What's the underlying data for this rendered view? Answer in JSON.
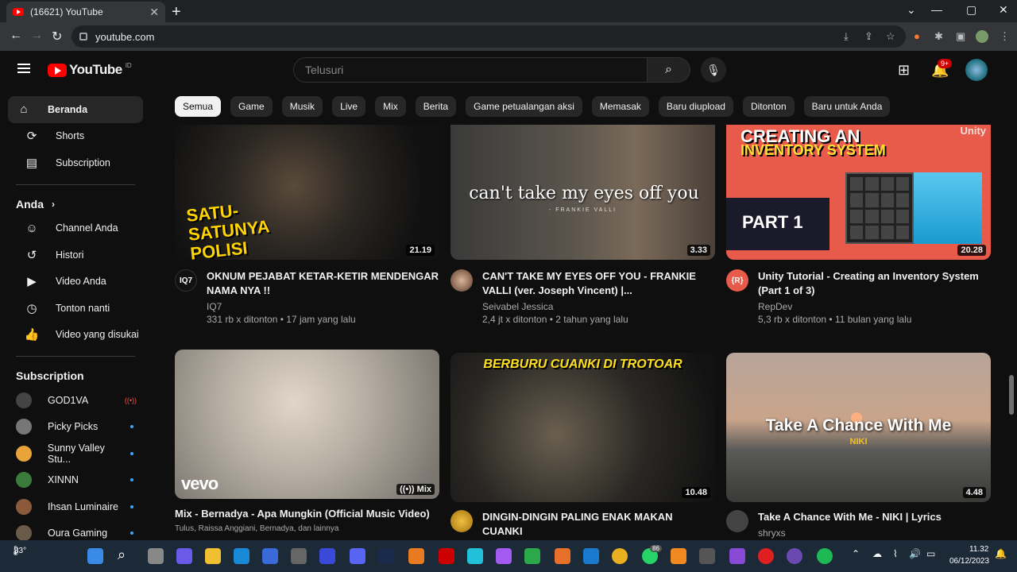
{
  "browser": {
    "tab_title": "(16621) YouTube",
    "url": "youtube.com"
  },
  "youtube": {
    "logo_text": "YouTube",
    "country_code": "ID",
    "search_placeholder": "Telusuri",
    "notifications_badge": "9+"
  },
  "sidebar": {
    "main": [
      {
        "label": "Beranda",
        "icon": "home-icon",
        "glyph": "⌂"
      },
      {
        "label": "Shorts",
        "icon": "shorts-icon",
        "glyph": "⟳"
      },
      {
        "label": "Subscription",
        "icon": "subscriptions-icon",
        "glyph": "▤"
      }
    ],
    "you_heading": "Anda",
    "you": [
      {
        "label": "Channel Anda",
        "icon": "channel-icon",
        "glyph": "☺"
      },
      {
        "label": "Histori",
        "icon": "history-icon",
        "glyph": "↺"
      },
      {
        "label": "Video Anda",
        "icon": "your-videos-icon",
        "glyph": "▶"
      },
      {
        "label": "Tonton nanti",
        "icon": "watch-later-icon",
        "glyph": "◷"
      },
      {
        "label": "Video yang disukai",
        "icon": "liked-videos-icon",
        "glyph": "👍"
      }
    ],
    "subs_heading": "Subscription",
    "subs": [
      {
        "label": "GOD1VA",
        "color": "#444",
        "status": "live"
      },
      {
        "label": "Picky Picks",
        "color": "#777",
        "status": "new"
      },
      {
        "label": "Sunny Valley Stu...",
        "color": "#e8a33a",
        "status": "new"
      },
      {
        "label": "XINNN",
        "color": "#3a7a3a",
        "status": "new"
      },
      {
        "label": "Ihsan Luminaire",
        "color": "#8a5a3a",
        "status": "new"
      },
      {
        "label": "Oura Gaming",
        "color": "#6a5a4a",
        "status": "new"
      }
    ]
  },
  "chips": [
    "Semua",
    "Game",
    "Musik",
    "Live",
    "Mix",
    "Berita",
    "Game petualangan aksi",
    "Memasak",
    "Baru diupload",
    "Ditonton",
    "Baru untuk Anda"
  ],
  "videos": [
    {
      "title": "OKNUM PEJABAT KETAR-KETIR MENDENGAR NAMA NYA !!",
      "channel": "IQ7",
      "meta": "331 rb x ditonton • 17 jam yang lalu",
      "duration": "21.19",
      "avatar_text": "IQ7",
      "thumb_text": "SATU-SATUNYA POLISI BRUTAL"
    },
    {
      "title": "CAN'T TAKE MY EYES OFF YOU - FRANKIE VALLI (ver. Joseph Vincent) |...",
      "channel": "Seivabel Jessica",
      "meta": "2,4 jt x ditonton • 2 tahun yang lalu",
      "duration": "3.33",
      "avatar_text": "",
      "thumb_text": "can't take my eyes off you",
      "thumb_sub": "- FRANKIE VALLI"
    },
    {
      "title": "Unity Tutorial - Creating an Inventory System (Part 1 of 3)",
      "channel": "RepDev",
      "meta": "5,3 rb x ditonton • 11 bulan yang lalu",
      "duration": "20.28",
      "avatar_text": "{R}",
      "thumb_text": "CREATING AN",
      "thumb_text2": "INVENTORY SYSTEM",
      "thumb_part": "PART 1",
      "thumb_brand": "Unity"
    },
    {
      "title": "Mix - Bernadya - Apa Mungkin (Official Music Video)",
      "channel": "Tulus, Raissa Anggiani, Bernadya, dan lainnya",
      "meta": "",
      "duration": "Mix",
      "avatar_text": "",
      "thumb_text": "vevo"
    },
    {
      "title": "DINGIN-DINGIN PALING ENAK MAKAN CUANKI",
      "channel": "",
      "meta": "",
      "duration": "10.48",
      "avatar_text": "",
      "thumb_text": "BERBURU CUANKI DI TROTOAR"
    },
    {
      "title": "Take A Chance With Me - NIKI | Lyrics",
      "channel": "shryxs",
      "meta": "",
      "duration": "4.48",
      "avatar_text": "",
      "thumb_text": "Take A Chance With Me",
      "thumb_sub": "NIKI"
    }
  ],
  "taskbar": {
    "temperature": "33°",
    "time": "11.32",
    "date": "06/12/2023",
    "whatsapp_badge": "86"
  }
}
